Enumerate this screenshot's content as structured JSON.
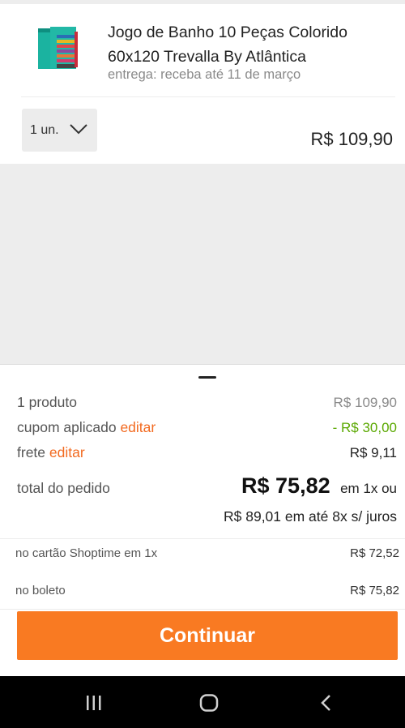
{
  "product": {
    "title": "Jogo de Banho 10 Peças Colorido 60x120 Trevalla By Atlântica",
    "delivery": "entrega: receba até 11 de março",
    "quantity": "1 un.",
    "price": "R$ 109,90"
  },
  "summary": {
    "products_label": "1 produto",
    "products_value": "R$ 109,90",
    "coupon_label": "cupom aplicado",
    "coupon_edit": "editar",
    "coupon_value": "- R$ 30,00",
    "shipping_label": "frete",
    "shipping_edit": "editar",
    "shipping_value": "R$ 9,11",
    "total_label": "total do pedido",
    "total_value": "R$ 75,82",
    "total_suffix": "em 1x ou",
    "installments": "R$ 89,01 em até 8x s/ juros",
    "card_label": "no cartão Shoptime em 1x",
    "card_value": "R$ 72,52",
    "boleto_label": "no boleto",
    "boleto_value": "R$ 75,82"
  },
  "continue_label": "Continuar",
  "colors": {
    "accent": "#f97a22",
    "link": "#f26a20",
    "discount": "#5aa800"
  },
  "nav": {
    "icons": [
      "recent-apps-icon",
      "home-icon",
      "back-icon"
    ]
  }
}
